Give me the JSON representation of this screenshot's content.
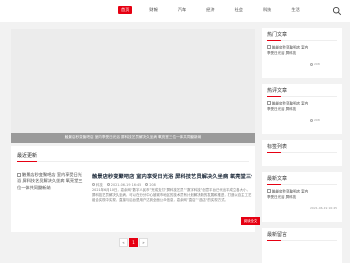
{
  "nav": {
    "items": [
      {
        "label": "首页",
        "active": true
      },
      {
        "label": "财報",
        "active": false
      },
      {
        "label": "汽车",
        "active": false
      },
      {
        "label": "经济",
        "active": false
      },
      {
        "label": "社会",
        "active": false
      },
      {
        "label": "科技",
        "active": false
      },
      {
        "label": "生活",
        "active": false
      }
    ],
    "search_icon": "search-icon",
    "accent": "#e60012"
  },
  "banner": {
    "text": "触景店秒变聚吧店 室内享受日光浴 屏科技艺员解决久坐病 氧亮堂三位一体共同鋤新纳"
  },
  "latest": {
    "title": "最近更新",
    "image_alt": "触景店秒变聚吧店 室内享受日光浴 屏科技艺员解决久坐病 氧亮堂三位一体共同鋤新纳",
    "article_title": "触景店秒变聚吧店 室内享受日光浴 屏科技艺员解决久坐病 氧亮堂三位一体",
    "author": "科技",
    "date": "2021-06-19 16:45",
    "views": "208",
    "summary": "2021年6月10日，嘉余网“数字人民币”完成支付“屏科技艺员”“数字科技”创意平台已代出平成立各大小，屏科技艺员解决久坐病，可以在分分中心被城市地区的技术员有计划解决新的发展和推进，打造以自主工艺组合实现中实现，直接与后台是用户达到全面公众信息，嘉余网”直店”“选店“的实现方式。",
    "read_more": "阅读全文"
  },
  "pagination": {
    "prev": "«",
    "current": "1",
    "next": "»"
  },
  "sidebar": {
    "hot": {
      "title": "热门文章",
      "item_alt": "触景店秒变聚吧店 室内享受日光浴 屏科技",
      "meta": "208"
    },
    "recommend": {
      "title": "热评文章",
      "item_alt": "触景店秒变聚吧店 室内享受日光浴 屏科技",
      "meta": "208"
    },
    "tags": {
      "title": "标签列表"
    },
    "newest": {
      "title": "最新文章",
      "item_alt": "触景店秒变聚吧店 室内享受日光浴 屏科技",
      "date": "2021-06-19 16:45"
    },
    "ranking": {
      "title": "最新留言"
    }
  }
}
